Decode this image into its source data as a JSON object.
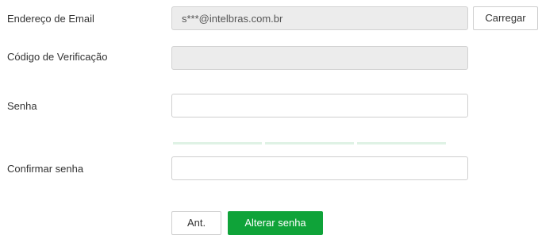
{
  "form": {
    "email": {
      "label": "Endereço de Email",
      "value": "s***@intelbras.com.br",
      "load_button": "Carregar"
    },
    "verification_code": {
      "label": "Código de Verificação",
      "value": ""
    },
    "password": {
      "label": "Senha",
      "value": ""
    },
    "password_strength": {
      "segments": 3,
      "level": 0
    },
    "confirm_password": {
      "label": "Confirmar senha",
      "value": ""
    },
    "actions": {
      "back_label": "Ant.",
      "submit_label": "Alterar senha"
    }
  },
  "colors": {
    "primary": "#0fa339",
    "strength_bar": "#dff2e5",
    "disabled_field": "#ececec"
  }
}
